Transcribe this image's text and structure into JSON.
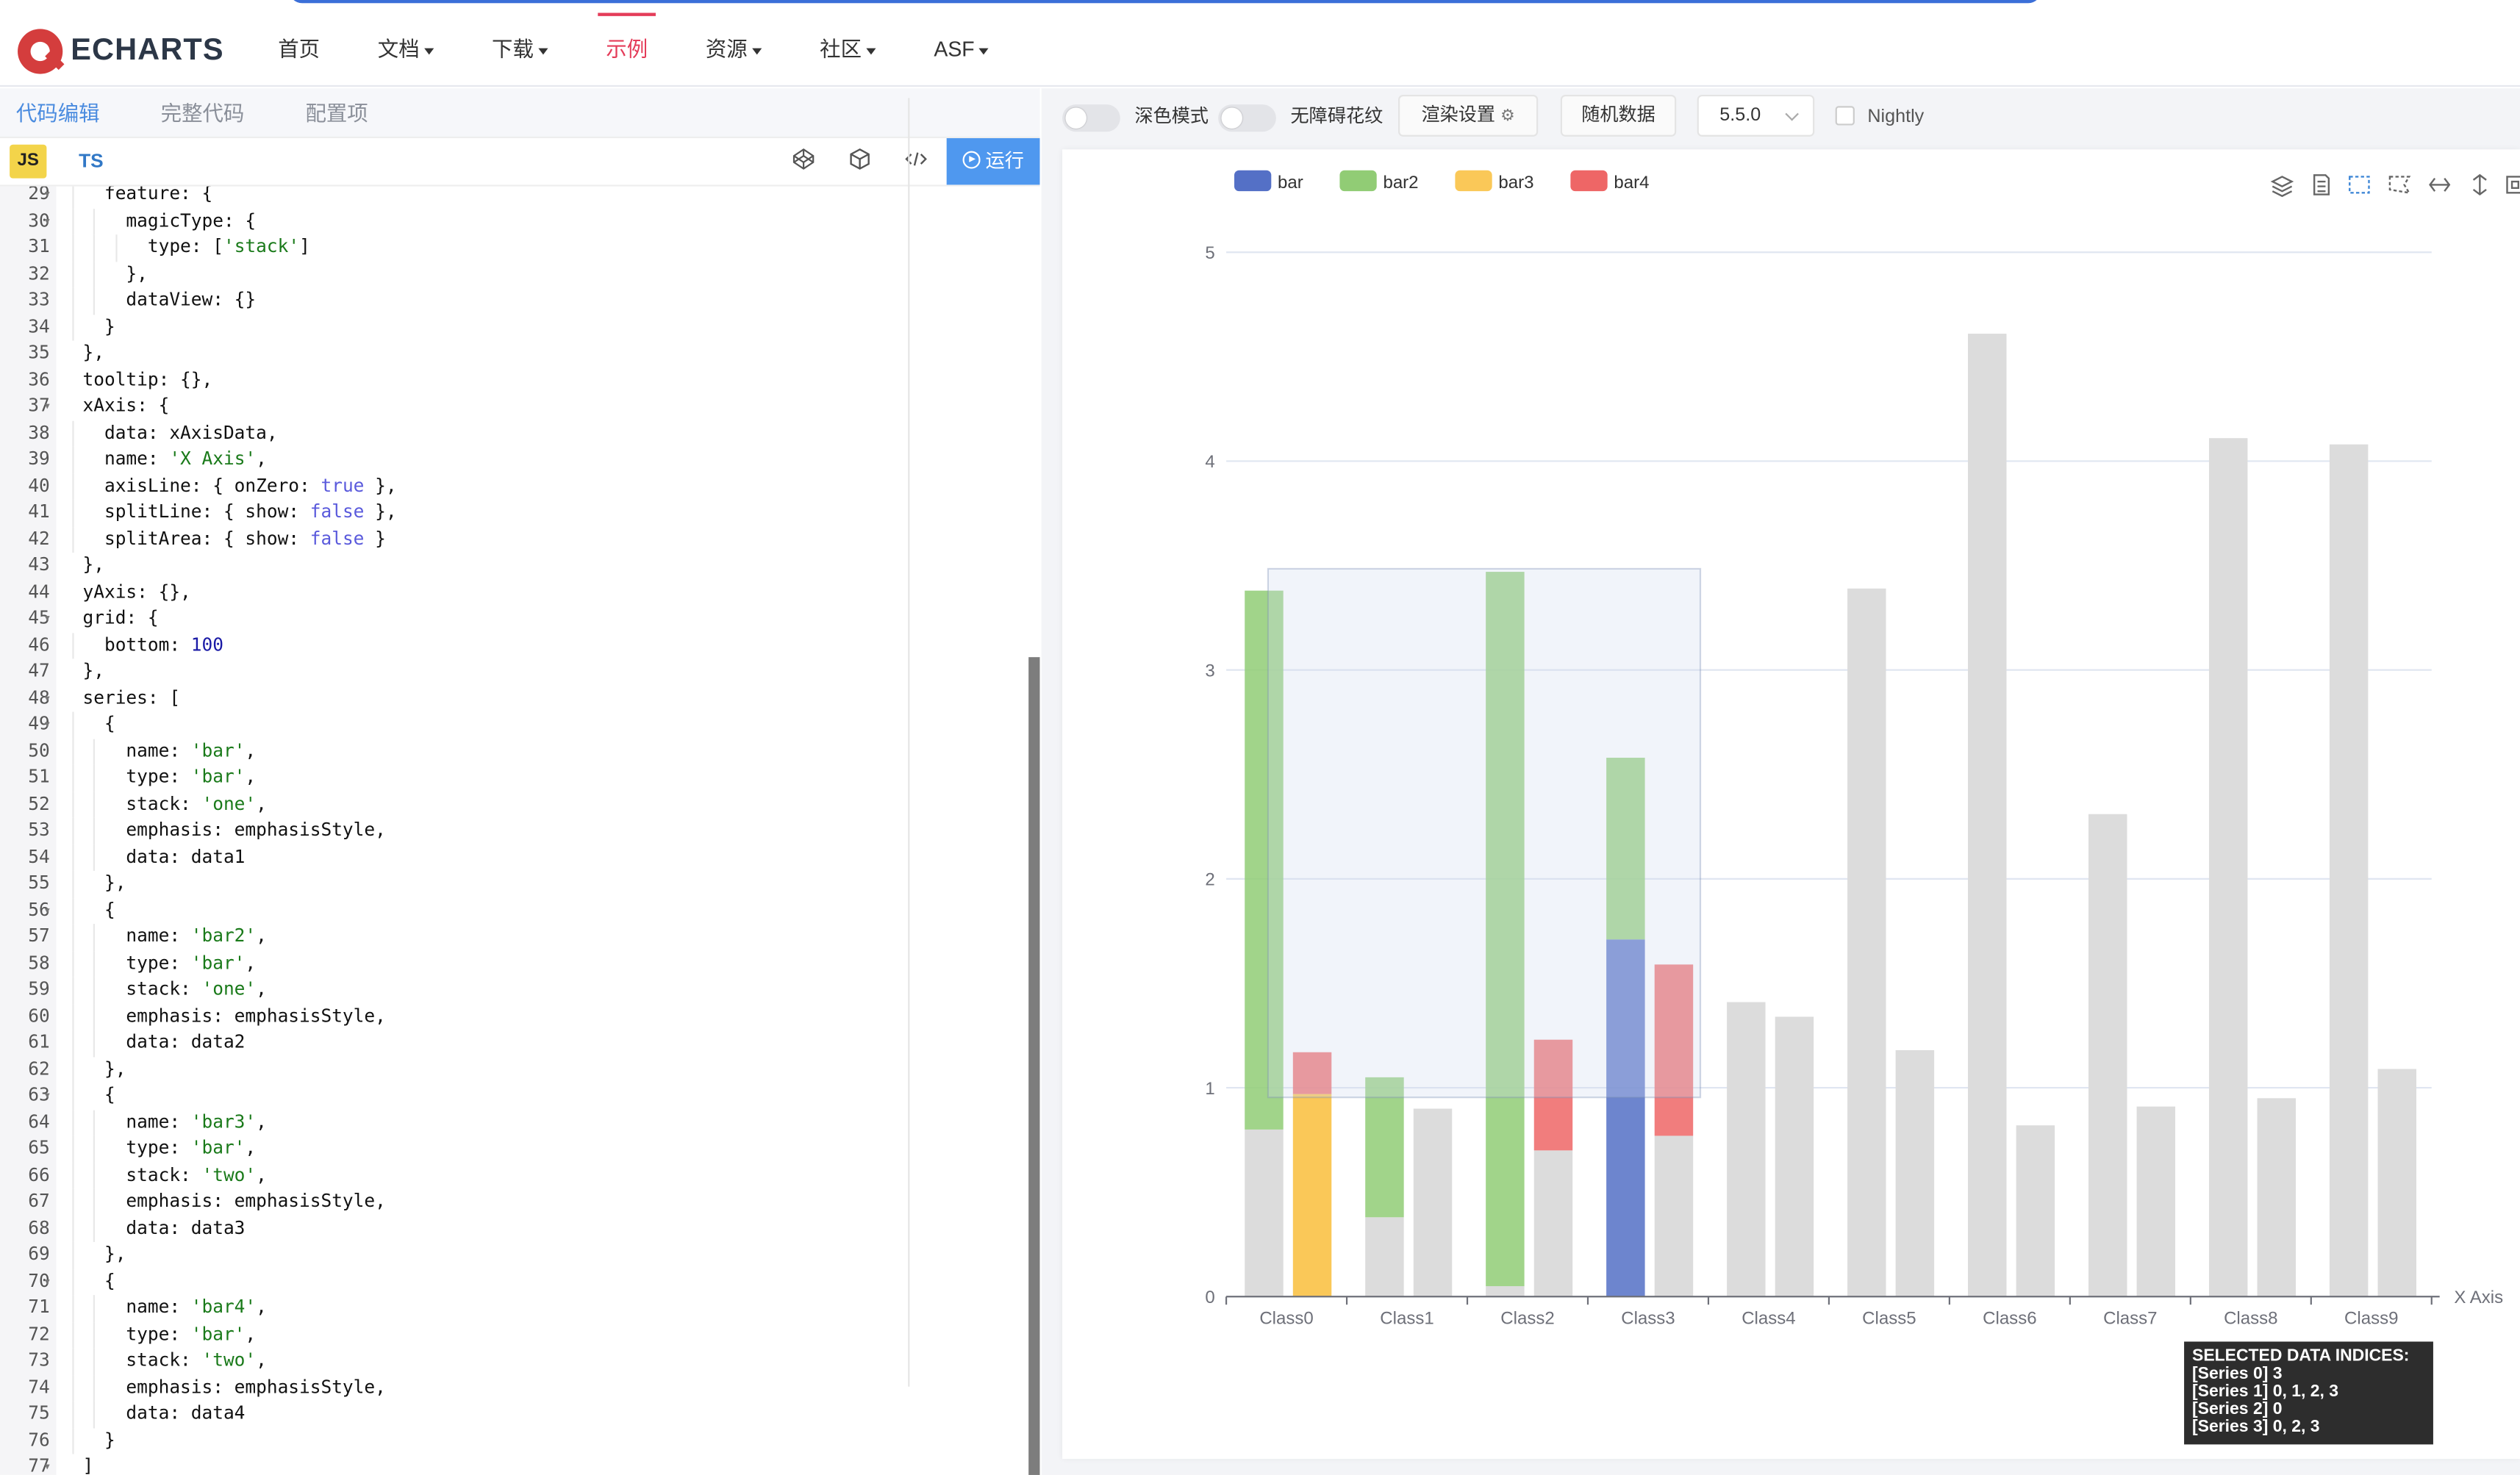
{
  "nav": {
    "logo": "ECHARTS",
    "items": [
      {
        "label": "首页",
        "dropdown": false,
        "active": false
      },
      {
        "label": "文档",
        "dropdown": true,
        "active": false
      },
      {
        "label": "下载",
        "dropdown": true,
        "active": false
      },
      {
        "label": "示例",
        "dropdown": false,
        "active": true
      },
      {
        "label": "资源",
        "dropdown": true,
        "active": false
      },
      {
        "label": "社区",
        "dropdown": true,
        "active": false
      },
      {
        "label": "ASF",
        "dropdown": true,
        "active": false
      }
    ]
  },
  "editor": {
    "tabs": [
      "代码编辑",
      "完整代码",
      "配置项"
    ],
    "lang_js": "JS",
    "lang_ts": "TS",
    "run_label": "运行",
    "lines": [
      {
        "n": "29",
        "fold": true,
        "text": "    feature: {"
      },
      {
        "n": "30",
        "fold": true,
        "text": "      magicType: {"
      },
      {
        "n": "31",
        "fold": false,
        "text": "        type: ['stack']"
      },
      {
        "n": "32",
        "fold": false,
        "text": "      },"
      },
      {
        "n": "33",
        "fold": false,
        "text": "      dataView: {}"
      },
      {
        "n": "34",
        "fold": false,
        "text": "    }"
      },
      {
        "n": "35",
        "fold": false,
        "text": "  },"
      },
      {
        "n": "36",
        "fold": false,
        "text": "  tooltip: {},"
      },
      {
        "n": "37",
        "fold": true,
        "text": "  xAxis: {"
      },
      {
        "n": "38",
        "fold": false,
        "text": "    data: xAxisData,"
      },
      {
        "n": "39",
        "fold": false,
        "text": "    name: 'X Axis',"
      },
      {
        "n": "40",
        "fold": false,
        "text": "    axisLine: { onZero: true },"
      },
      {
        "n": "41",
        "fold": false,
        "text": "    splitLine: { show: false },"
      },
      {
        "n": "42",
        "fold": false,
        "text": "    splitArea: { show: false }"
      },
      {
        "n": "43",
        "fold": false,
        "text": "  },"
      },
      {
        "n": "44",
        "fold": false,
        "text": "  yAxis: {},"
      },
      {
        "n": "45",
        "fold": true,
        "text": "  grid: {"
      },
      {
        "n": "46",
        "fold": false,
        "text": "    bottom: 100"
      },
      {
        "n": "47",
        "fold": false,
        "text": "  },"
      },
      {
        "n": "48",
        "fold": true,
        "text": "  series: ["
      },
      {
        "n": "49",
        "fold": true,
        "text": "    {"
      },
      {
        "n": "50",
        "fold": false,
        "text": "      name: 'bar',"
      },
      {
        "n": "51",
        "fold": false,
        "text": "      type: 'bar',"
      },
      {
        "n": "52",
        "fold": false,
        "text": "      stack: 'one',"
      },
      {
        "n": "53",
        "fold": false,
        "text": "      emphasis: emphasisStyle,"
      },
      {
        "n": "54",
        "fold": false,
        "text": "      data: data1"
      },
      {
        "n": "55",
        "fold": false,
        "text": "    },"
      },
      {
        "n": "56",
        "fold": true,
        "text": "    {"
      },
      {
        "n": "57",
        "fold": false,
        "text": "      name: 'bar2',"
      },
      {
        "n": "58",
        "fold": false,
        "text": "      type: 'bar',"
      },
      {
        "n": "59",
        "fold": false,
        "text": "      stack: 'one',"
      },
      {
        "n": "60",
        "fold": false,
        "text": "      emphasis: emphasisStyle,"
      },
      {
        "n": "61",
        "fold": false,
        "text": "      data: data2"
      },
      {
        "n": "62",
        "fold": false,
        "text": "    },"
      },
      {
        "n": "63",
        "fold": true,
        "text": "    {"
      },
      {
        "n": "64",
        "fold": false,
        "text": "      name: 'bar3',"
      },
      {
        "n": "65",
        "fold": false,
        "text": "      type: 'bar',"
      },
      {
        "n": "66",
        "fold": false,
        "text": "      stack: 'two',"
      },
      {
        "n": "67",
        "fold": false,
        "text": "      emphasis: emphasisStyle,"
      },
      {
        "n": "68",
        "fold": false,
        "text": "      data: data3"
      },
      {
        "n": "69",
        "fold": false,
        "text": "    },"
      },
      {
        "n": "70",
        "fold": true,
        "text": "    {"
      },
      {
        "n": "71",
        "fold": false,
        "text": "      name: 'bar4',"
      },
      {
        "n": "72",
        "fold": false,
        "text": "      type: 'bar',"
      },
      {
        "n": "73",
        "fold": false,
        "text": "      stack: 'two',"
      },
      {
        "n": "74",
        "fold": false,
        "text": "      emphasis: emphasisStyle,"
      },
      {
        "n": "75",
        "fold": false,
        "text": "      data: data4"
      },
      {
        "n": "76",
        "fold": false,
        "text": "    }"
      },
      {
        "n": "77",
        "fold": true,
        "text": "  ]"
      }
    ]
  },
  "toolbar": {
    "dark_mode": "深色模式",
    "aria_pattern": "无障碍花纹",
    "render_settings": "渲染设置",
    "random_data": "随机数据",
    "version": "5.5.0",
    "nightly": "Nightly"
  },
  "chart_data": {
    "type": "bar",
    "categories": [
      "Class0",
      "Class1",
      "Class2",
      "Class3",
      "Class4",
      "Class5",
      "Class6",
      "Class7",
      "Class8",
      "Class9"
    ],
    "xlabel": "X Axis",
    "ylim": [
      0,
      5
    ],
    "yticks": [
      "0",
      "1",
      "2",
      "3",
      "4",
      "5"
    ],
    "legend": [
      "bar",
      "bar2",
      "bar3",
      "bar4"
    ],
    "stacks": {
      "one": [
        "bar",
        "bar2"
      ],
      "two": [
        "bar3",
        "bar4"
      ]
    },
    "series": [
      {
        "name": "bar",
        "stack": "one",
        "color": "#5470c6",
        "values": [
          0.8,
          0.38,
          0.05,
          1.71,
          1.41,
          3.39,
          4.61,
          2.31,
          4.11,
          4.08
        ]
      },
      {
        "name": "bar2",
        "stack": "one",
        "color": "#91cc75",
        "values": [
          2.58,
          0.67,
          3.42,
          0.87,
          0,
          0,
          0,
          0,
          0,
          0
        ]
      },
      {
        "name": "bar3",
        "stack": "two",
        "color": "#fac858",
        "values": [
          0.97,
          0.9,
          0.7,
          0.77,
          1.34,
          1.18,
          0.82,
          0.91,
          0.95,
          1.09
        ]
      },
      {
        "name": "bar4",
        "stack": "two",
        "color": "#ee6666",
        "values": [
          0.2,
          0,
          0.53,
          0.82,
          0,
          0,
          0,
          0,
          0,
          0
        ]
      }
    ],
    "selection_info": {
      "title": "SELECTED DATA INDICES:",
      "lines": [
        "[Series 0] 3",
        "[Series 1] 0, 1, 2, 3",
        "[Series 2] 0",
        "[Series 3] 0, 2, 3"
      ]
    }
  }
}
